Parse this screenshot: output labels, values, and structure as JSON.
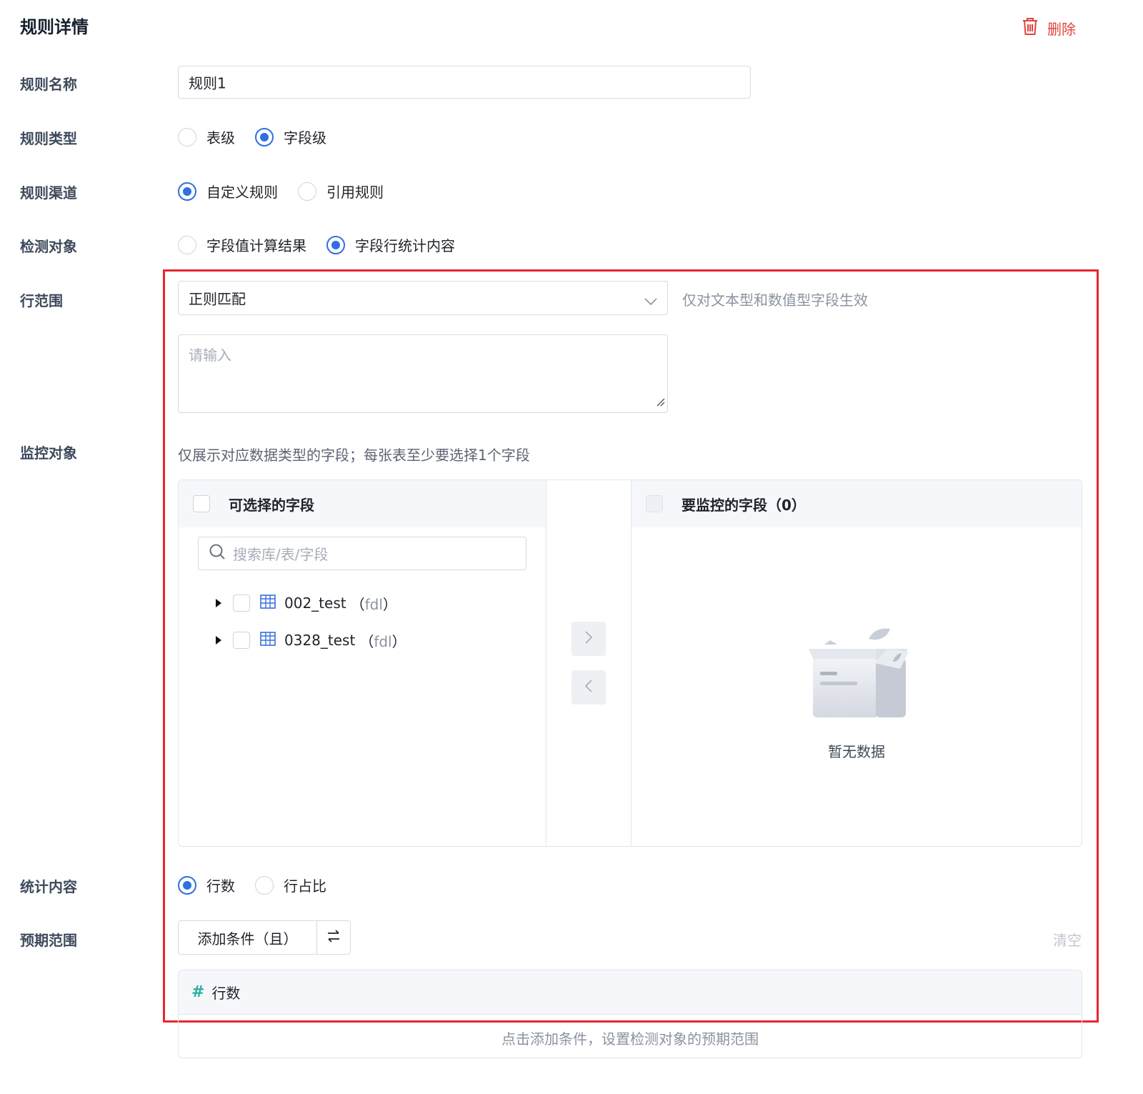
{
  "page": {
    "title": "规则详情",
    "delete_label": "删除"
  },
  "colors": {
    "accent": "#2f6fe0",
    "danger": "#e0433b",
    "highlight_border": "#e8262f"
  },
  "form": {
    "rule_name": {
      "label": "规则名称",
      "value": "规则1"
    },
    "rule_type": {
      "label": "规则类型",
      "options": [
        "表级",
        "字段级"
      ],
      "selected": "字段级"
    },
    "rule_channel": {
      "label": "规则渠道",
      "options": [
        "自定义规则",
        "引用规则"
      ],
      "selected": "自定义规则"
    },
    "detect_target": {
      "label": "检测对象",
      "options": [
        "字段值计算结果",
        "字段行统计内容"
      ],
      "selected": "字段行统计内容"
    },
    "row_range": {
      "label": "行范围",
      "select_value": "正则匹配",
      "hint": "仅对文本型和数值型字段生效",
      "textarea_placeholder": "请输入"
    },
    "monitor_target": {
      "label": "监控对象",
      "hint": "仅展示对应数据类型的字段；每张表至少要选择1个字段",
      "left_title": "可选择的字段",
      "right_title": "要监控的字段（0）",
      "search_placeholder": "搜索库/表/字段",
      "tree": [
        {
          "name": "002_test",
          "open_paren": "（",
          "schema": "fdl",
          "close_paren": "）"
        },
        {
          "name": "0328_test",
          "open_paren": "（",
          "schema": "fdl",
          "close_paren": "）"
        }
      ],
      "empty_text": "暂无数据"
    },
    "stat_content": {
      "label": "统计内容",
      "options": [
        "行数",
        "行占比"
      ],
      "selected": "行数"
    },
    "expected_range": {
      "label": "预期范围",
      "add_condition": "添加条件（且）",
      "clear": "清空",
      "condition_field": "行数",
      "empty_hint": "点击添加条件，设置检测对象的预期范围"
    }
  }
}
